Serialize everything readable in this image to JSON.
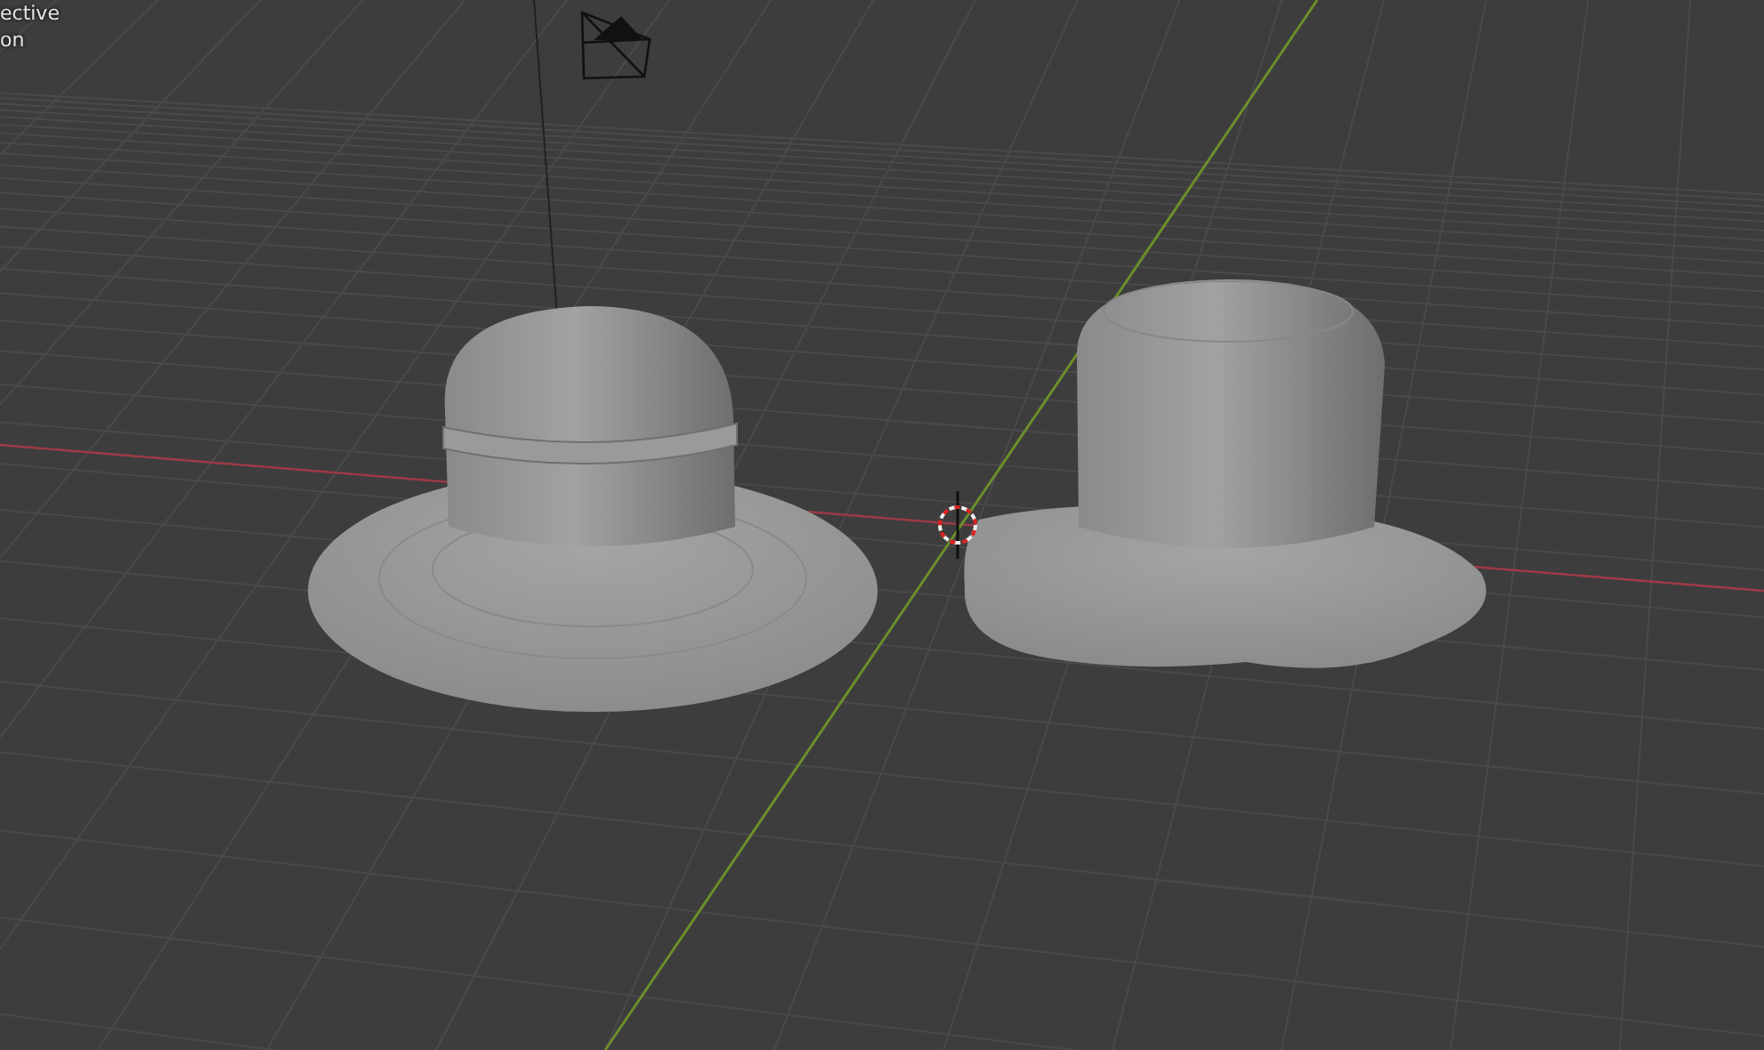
{
  "viewport": {
    "overlay_text": [
      "ective",
      "on"
    ]
  }
}
